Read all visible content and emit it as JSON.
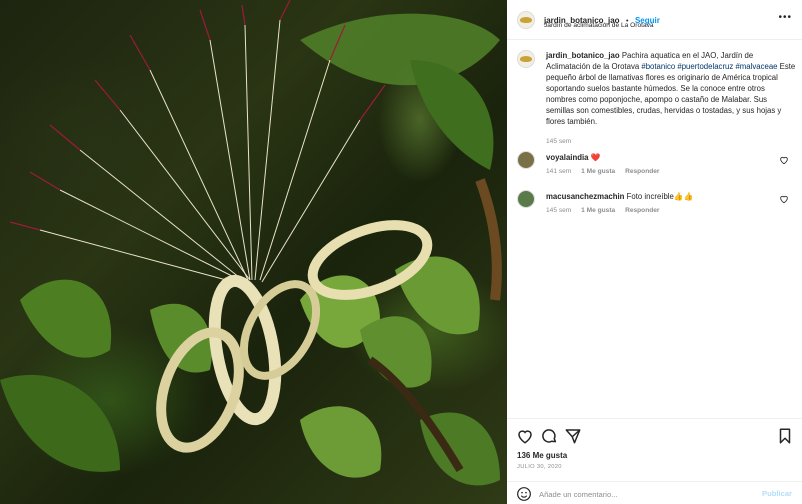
{
  "post": {
    "username": "jardin_botanico_jao",
    "separator": "•",
    "follow_label": "Seguir",
    "location": "Jardín de aclimatación de La Orotava"
  },
  "caption": {
    "username": "jardin_botanico_jao",
    "text_1": "Pachira aquatica en el JAO, Jardín de Aclimatación de la Orotava",
    "tag_1": "#botanico",
    "tag_2": "#puertodelacruz",
    "tag_3": "#malvaceae",
    "text_2": "Este pequeño árbol de llamativas flores es originario de América tropical soportando suelos bastante húmedos. Se la conoce entre otros nombres como poponjoche, apompo o castaño de Malabar. Sus semillas son comestibles, crudas, hervidas o tostadas, y sus hojas y flores también.",
    "time": "145 sem"
  },
  "comments": [
    {
      "username": "voyalaindia",
      "text": "❤️",
      "time": "141 sem",
      "likes": "1 Me gusta",
      "reply": "Responder"
    },
    {
      "username": "macusanchezmachin",
      "text": "Foto increíble👍👍",
      "time": "145 sem",
      "likes": "1 Me gusta",
      "reply": "Responder"
    }
  ],
  "footer": {
    "likes": "136 Me gusta",
    "date": "JULIO 30, 2020",
    "comment_placeholder": "Añade un comentario...",
    "publish_label": "Publicar"
  },
  "icons": {
    "like": "heart-icon",
    "comment": "comment-icon",
    "share": "send-icon",
    "save": "bookmark-icon",
    "emoji": "emoji-icon",
    "more": "more-icon"
  },
  "colors": {
    "link_blue": "#0095f6",
    "tag_blue": "#00376b",
    "muted": "#8e8e8e",
    "publish_disabled": "#b2dffc"
  }
}
